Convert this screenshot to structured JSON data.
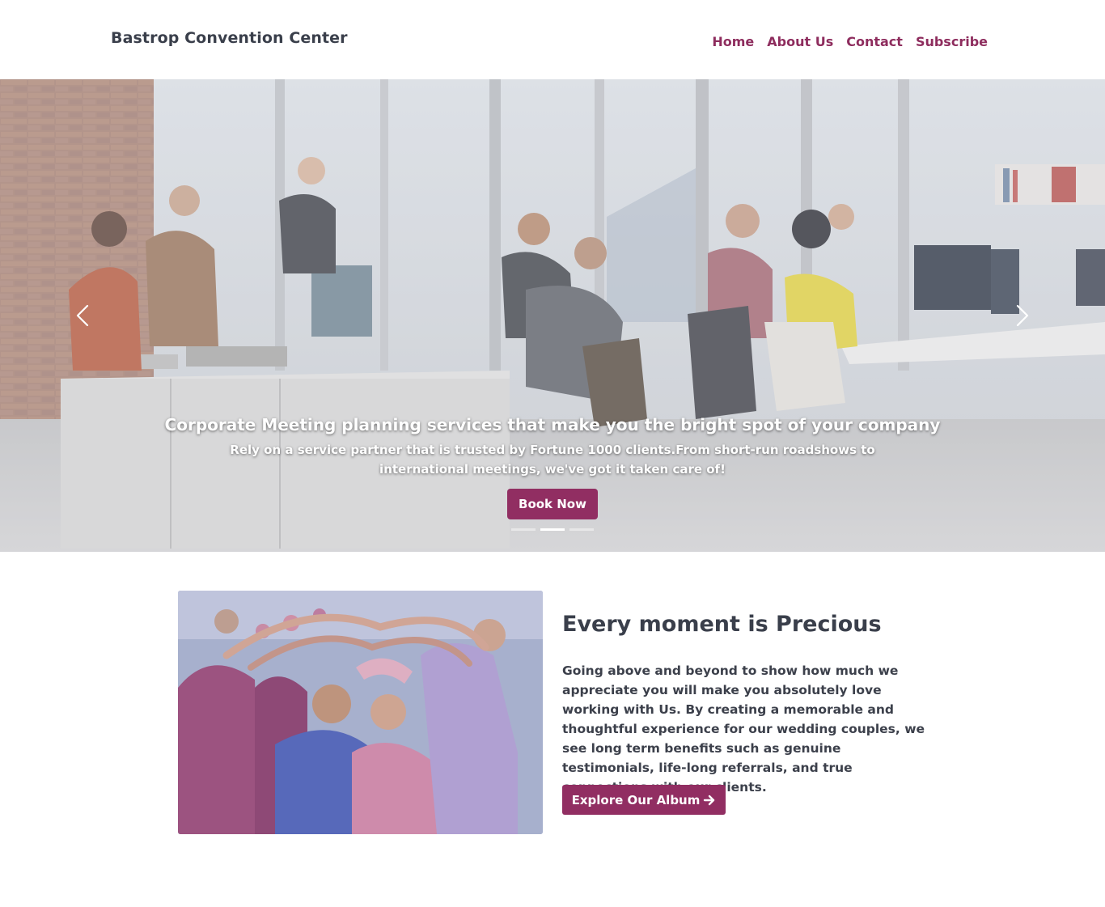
{
  "header": {
    "brand": "Bastrop Convention Center",
    "nav": [
      "Home",
      "About Us",
      "Contact",
      "Subscribe"
    ]
  },
  "hero": {
    "title": "Corporate Meeting planning services that make you the bright spot of your company",
    "subtitle": "Rely on a service partner that is trusted by Fortune 1000 clients.From short-run roadshows to international meetings, we've got it taken care of!",
    "button": "Book Now",
    "slide_count": 3,
    "active_slide": 2,
    "prev_icon": "chevron-left-icon",
    "next_icon": "chevron-right-icon"
  },
  "feature": {
    "title": "Every moment is Precious",
    "text": "Going above and beyond to show how much we appreciate you will make you absolutely love working with Us. By creating a memorable and thoughtful experience for our wedding couples, we see long term benefits such as genuine testimonials, life-long referrals, and true connections with our clients.",
    "button": "Explore Our Album",
    "button_icon": "arrow-right-icon"
  },
  "colors": {
    "accent": "#912e62",
    "nav_link": "#8e2d5e",
    "heading": "#3a3f4b"
  }
}
